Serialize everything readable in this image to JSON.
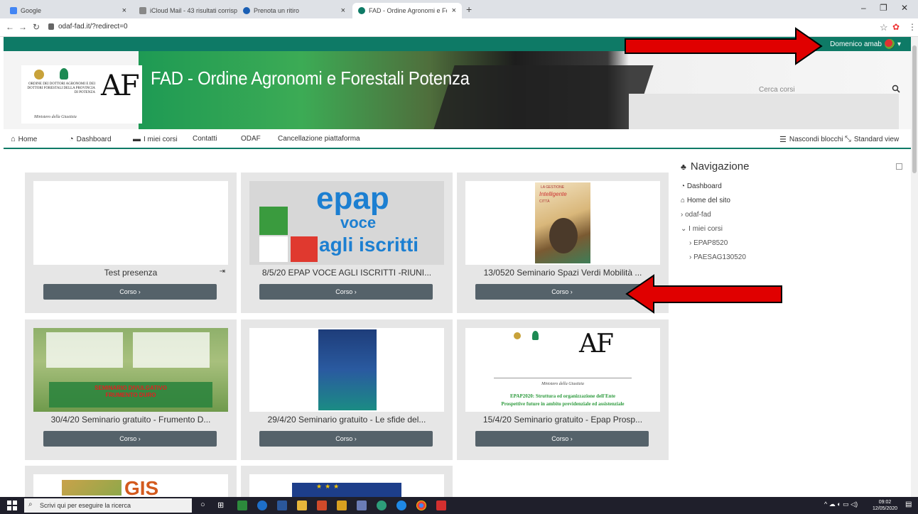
{
  "browser": {
    "tabs": [
      {
        "label": "Google",
        "color": "#4285f4"
      },
      {
        "label": "iCloud Mail - 43 risultati corrisp",
        "color": "#888888"
      },
      {
        "label": "Prenota un ritiro",
        "color": "#1a5fb4"
      },
      {
        "label": "FAD - Ordine Agronomi e Foresta",
        "color": "#0e7a66"
      }
    ],
    "url": "odaf-fad.it/?redirect=0"
  },
  "header": {
    "user_name": "Domenico amab",
    "site_title": "FAD - Ordine Agronomi e Forestali Potenza",
    "search_placeholder": "Cerca corsi",
    "logo": {
      "ordine_text": "ORDINE DEI DOTTORI AGRONOMI E DEI DOTTORI FORESTALI DELLA PROVINCIA DI POTENZA",
      "ministero": "Ministero della Giustizia",
      "mark": "AF"
    }
  },
  "nav": {
    "home": "Home",
    "dashboard": "Dashboard",
    "miei_corsi": "I miei corsi",
    "contatti": "Contatti",
    "odaf": "ODAF",
    "cancellazione": "Cancellazione piattaforma",
    "nascondi": "Nascondi blocchi",
    "standard": "Standard view"
  },
  "courses": [
    {
      "title": "Test presenza",
      "button": "Corso ›"
    },
    {
      "title": "8/5/20 EPAP VOCE AGLI ISCRITTI -RIUNI...",
      "button": "Corso ›",
      "thumb_text": {
        "a": "epap",
        "b": "voce",
        "c": "agli iscritti"
      }
    },
    {
      "title": "13/0520 Seminario Spazi Verdi Mobilità ...",
      "button": "Corso ›",
      "thumb_text": {
        "a": "LA GESTIONE",
        "b": "Intelligente",
        "c": "CITTÀ"
      }
    },
    {
      "title": "30/4/20 Seminario gratuito - Frumento D...",
      "button": "Corso ›",
      "thumb_text": {
        "a": "SEMINARIO DIVULGATIVO",
        "b": "FRUMENTO DURO"
      }
    },
    {
      "title": "29/4/20 Seminario gratuito - Le sfide del...",
      "button": "Corso ›"
    },
    {
      "title": "15/4/20 Seminario gratuito - Epap Prosp...",
      "button": "Corso ›",
      "thumb_text": {
        "a": "Ministero della Giustizia",
        "b": "EPAP2020: Struttura ed organizzazione dell'Ente",
        "c": "Prospettive future in ambito previdenziale ed assistenziale"
      }
    },
    {
      "thumb_text": {
        "a": "GIS"
      }
    },
    {}
  ],
  "sidebar": {
    "title": "Navigazione",
    "items": [
      "Dashboard",
      "Home del sito",
      "odaf-fad",
      "I miei corsi",
      "EPAP8520",
      "PAESAG130520"
    ]
  },
  "taskbar": {
    "search_placeholder": "Scrivi qui per eseguire la ricerca",
    "time": "09:02",
    "date": "12/05/2020"
  },
  "colors": {
    "accent": "#0e7a66",
    "button": "#55626a",
    "arrow": "#e00000"
  }
}
